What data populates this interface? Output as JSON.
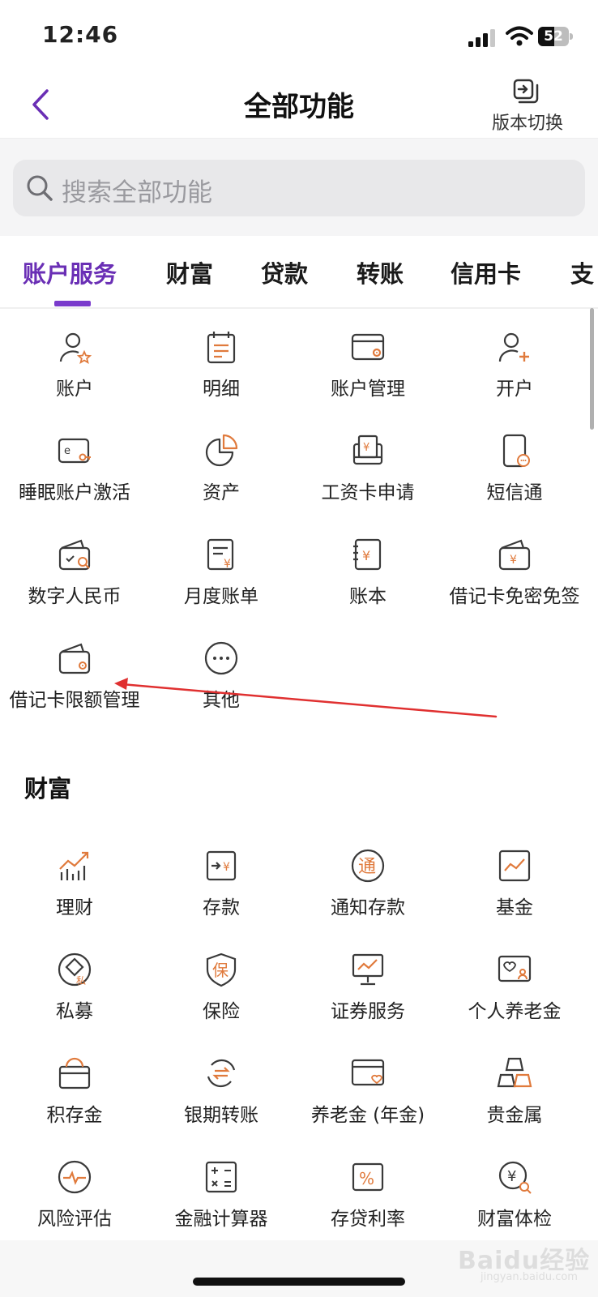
{
  "status_bar": {
    "time": "12:46",
    "battery": "52",
    "battery_level": 0.52
  },
  "navbar": {
    "title": "全部功能",
    "version_switch_label": "版本切换"
  },
  "search": {
    "placeholder": "搜索全部功能"
  },
  "tabs": [
    {
      "label": "账户服务",
      "active": true
    },
    {
      "label": "财富",
      "active": false
    },
    {
      "label": "贷款",
      "active": false
    },
    {
      "label": "转账",
      "active": false
    },
    {
      "label": "信用卡",
      "active": false
    },
    {
      "label": "支",
      "active": false
    }
  ],
  "sections": [
    {
      "title": "",
      "items": [
        {
          "label": "账户",
          "icon": "user-star-icon"
        },
        {
          "label": "明细",
          "icon": "calendar-list-icon"
        },
        {
          "label": "账户管理",
          "icon": "card-gear-icon"
        },
        {
          "label": "开户",
          "icon": "user-plus-icon"
        },
        {
          "label": "睡眠账户激活",
          "icon": "card-key-icon"
        },
        {
          "label": "资产",
          "icon": "pie-chart-icon"
        },
        {
          "label": "工资卡申请",
          "icon": "salary-card-icon"
        },
        {
          "label": "短信通",
          "icon": "phone-message-icon"
        },
        {
          "label": "数字人民币",
          "icon": "wallet-search-icon"
        },
        {
          "label": "月度账单",
          "icon": "bill-yuan-icon"
        },
        {
          "label": "账本",
          "icon": "ledger-yuan-icon"
        },
        {
          "label": "借记卡免密免签",
          "icon": "wallet-yuan-icon"
        },
        {
          "label": "借记卡限额管理",
          "icon": "wallet-gear-icon"
        },
        {
          "label": "其他",
          "icon": "more-dots-icon"
        }
      ]
    },
    {
      "title": "财富",
      "items": [
        {
          "label": "理财",
          "icon": "growth-chart-icon"
        },
        {
          "label": "存款",
          "icon": "deposit-icon"
        },
        {
          "label": "通知存款",
          "icon": "notice-circle-icon"
        },
        {
          "label": "基金",
          "icon": "fund-chart-icon"
        },
        {
          "label": "私募",
          "icon": "private-diamond-icon"
        },
        {
          "label": "保险",
          "icon": "insurance-shield-icon"
        },
        {
          "label": "证券服务",
          "icon": "securities-monitor-icon"
        },
        {
          "label": "个人养老金",
          "icon": "pension-card-icon"
        },
        {
          "label": "积存金",
          "icon": "gold-box-icon"
        },
        {
          "label": "银期转账",
          "icon": "exchange-circle-icon"
        },
        {
          "label": "养老金 (年金)",
          "icon": "card-heart-icon"
        },
        {
          "label": "贵金属",
          "icon": "gold-bars-icon"
        },
        {
          "label": "风险评估",
          "icon": "pulse-circle-icon"
        },
        {
          "label": "金融计算器",
          "icon": "calculator-icon"
        },
        {
          "label": "存贷利率",
          "icon": "percent-icon"
        },
        {
          "label": "财富体检",
          "icon": "yuan-search-icon"
        }
      ]
    }
  ],
  "watermark": {
    "logo": "Baidu经验",
    "sub": "jingyan.baidu.com"
  },
  "colors": {
    "accent": "#7a3bcc",
    "icon_stroke": "#3a3a3a",
    "icon_highlight": "#e07a3c",
    "annotation": "#e03030"
  }
}
